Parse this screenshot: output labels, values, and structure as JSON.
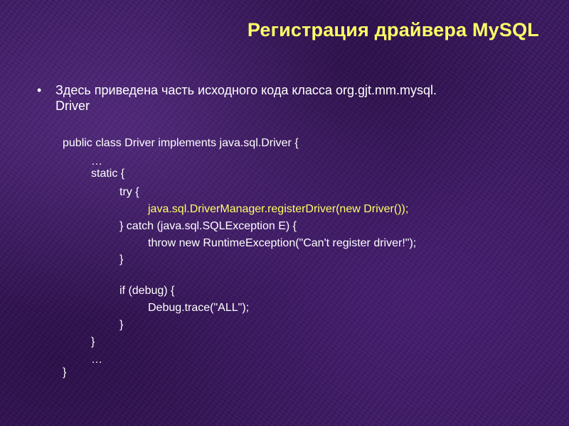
{
  "title": "Регистрация драйвера MySQL",
  "bullet": {
    "symbol": "•",
    "line1": "Здесь приведена часть исходного кода класса org.gjt.mm.mysql.",
    "line2": "Driver"
  },
  "code": {
    "lines": [
      "public class Driver implements java.sql.Driver {",
      "…",
      "static {",
      "try {",
      "java.sql.DriverManager.registerDriver(new Driver());",
      "} catch (java.sql.SQLException E) {",
      "throw new RuntimeException(\"Can't register driver!\");",
      "}",
      "if (debug) {",
      "Debug.trace(\"ALL\");",
      "}",
      "}",
      "…",
      "}"
    ]
  },
  "colors": {
    "title": "#ffff66",
    "text": "#ffffff",
    "highlight": "#ffff66",
    "background": "#3a1860"
  }
}
